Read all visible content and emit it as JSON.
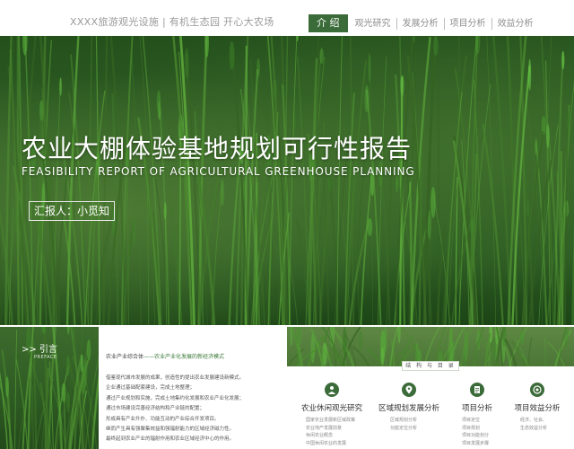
{
  "header": {
    "brand": "XXXX旅游观光设施 | 有机生态园  开心大农场",
    "nav": [
      {
        "label": "介 绍",
        "active": true
      },
      {
        "label": "观光研究",
        "active": false
      },
      {
        "label": "发展分析",
        "active": false
      },
      {
        "label": "项目分析",
        "active": false
      },
      {
        "label": "效益分析",
        "active": false
      }
    ]
  },
  "hero": {
    "title": "农业大棚体验基地规划可行性报告",
    "subtitle": "FEASIBILITY REPORT OF AGRICULTURAL GREENHOUSE PLANNING",
    "reporter": "汇报人：小觅知"
  },
  "preface": {
    "title": ">> 引言",
    "subtitle": "PREFACE",
    "heading_lead": "农业产业综合体",
    "heading_accent": "——农业产业化发展的新经济模式",
    "lines": [
      "借鉴现代城市发展的成果，创造性的提出农业发展建设新模式。",
      "企业通过基础配套建设，完成土地整理；",
      "通过产业规划和实施，完成土地集约化发展和农业产业化发展；",
      "通过市场建设完善经济结构和产业链的配置；",
      "形成具有产业升扑、功能互动的产业综合开发项目。",
      "继而产生具有强聚集效益和强辐射能力的区域经济磁力性。",
      "最终起到农业产业的辐射作用和农业区域经济中心的作用。"
    ]
  },
  "toc": {
    "badge": "结 构 与 目 录",
    "columns": [
      {
        "icon": "person-icon",
        "label": "农业休闲观光研究",
        "items": [
          "国家农业发展新区域政策",
          "农业地产发展前景",
          "休闲农业概念",
          "中国休闲农业的发展"
        ]
      },
      {
        "icon": "location-pin-icon",
        "label": "区域规划发展分析",
        "items": [
          "区域规划分析",
          "功能定位分析"
        ]
      },
      {
        "icon": "document-icon",
        "label": "项目分析",
        "items": [
          "项目定位",
          "项目规划",
          "项目功能划分",
          "项目发展步骤"
        ]
      },
      {
        "icon": "target-icon",
        "label": "项目效益分析",
        "items": [
          "经济、社会、",
          "生态效益分析"
        ]
      }
    ]
  },
  "colors": {
    "brand_green": "#3c6b3a",
    "nav_text": "#8f8f8f",
    "accent_text": "#3c7a3a"
  }
}
